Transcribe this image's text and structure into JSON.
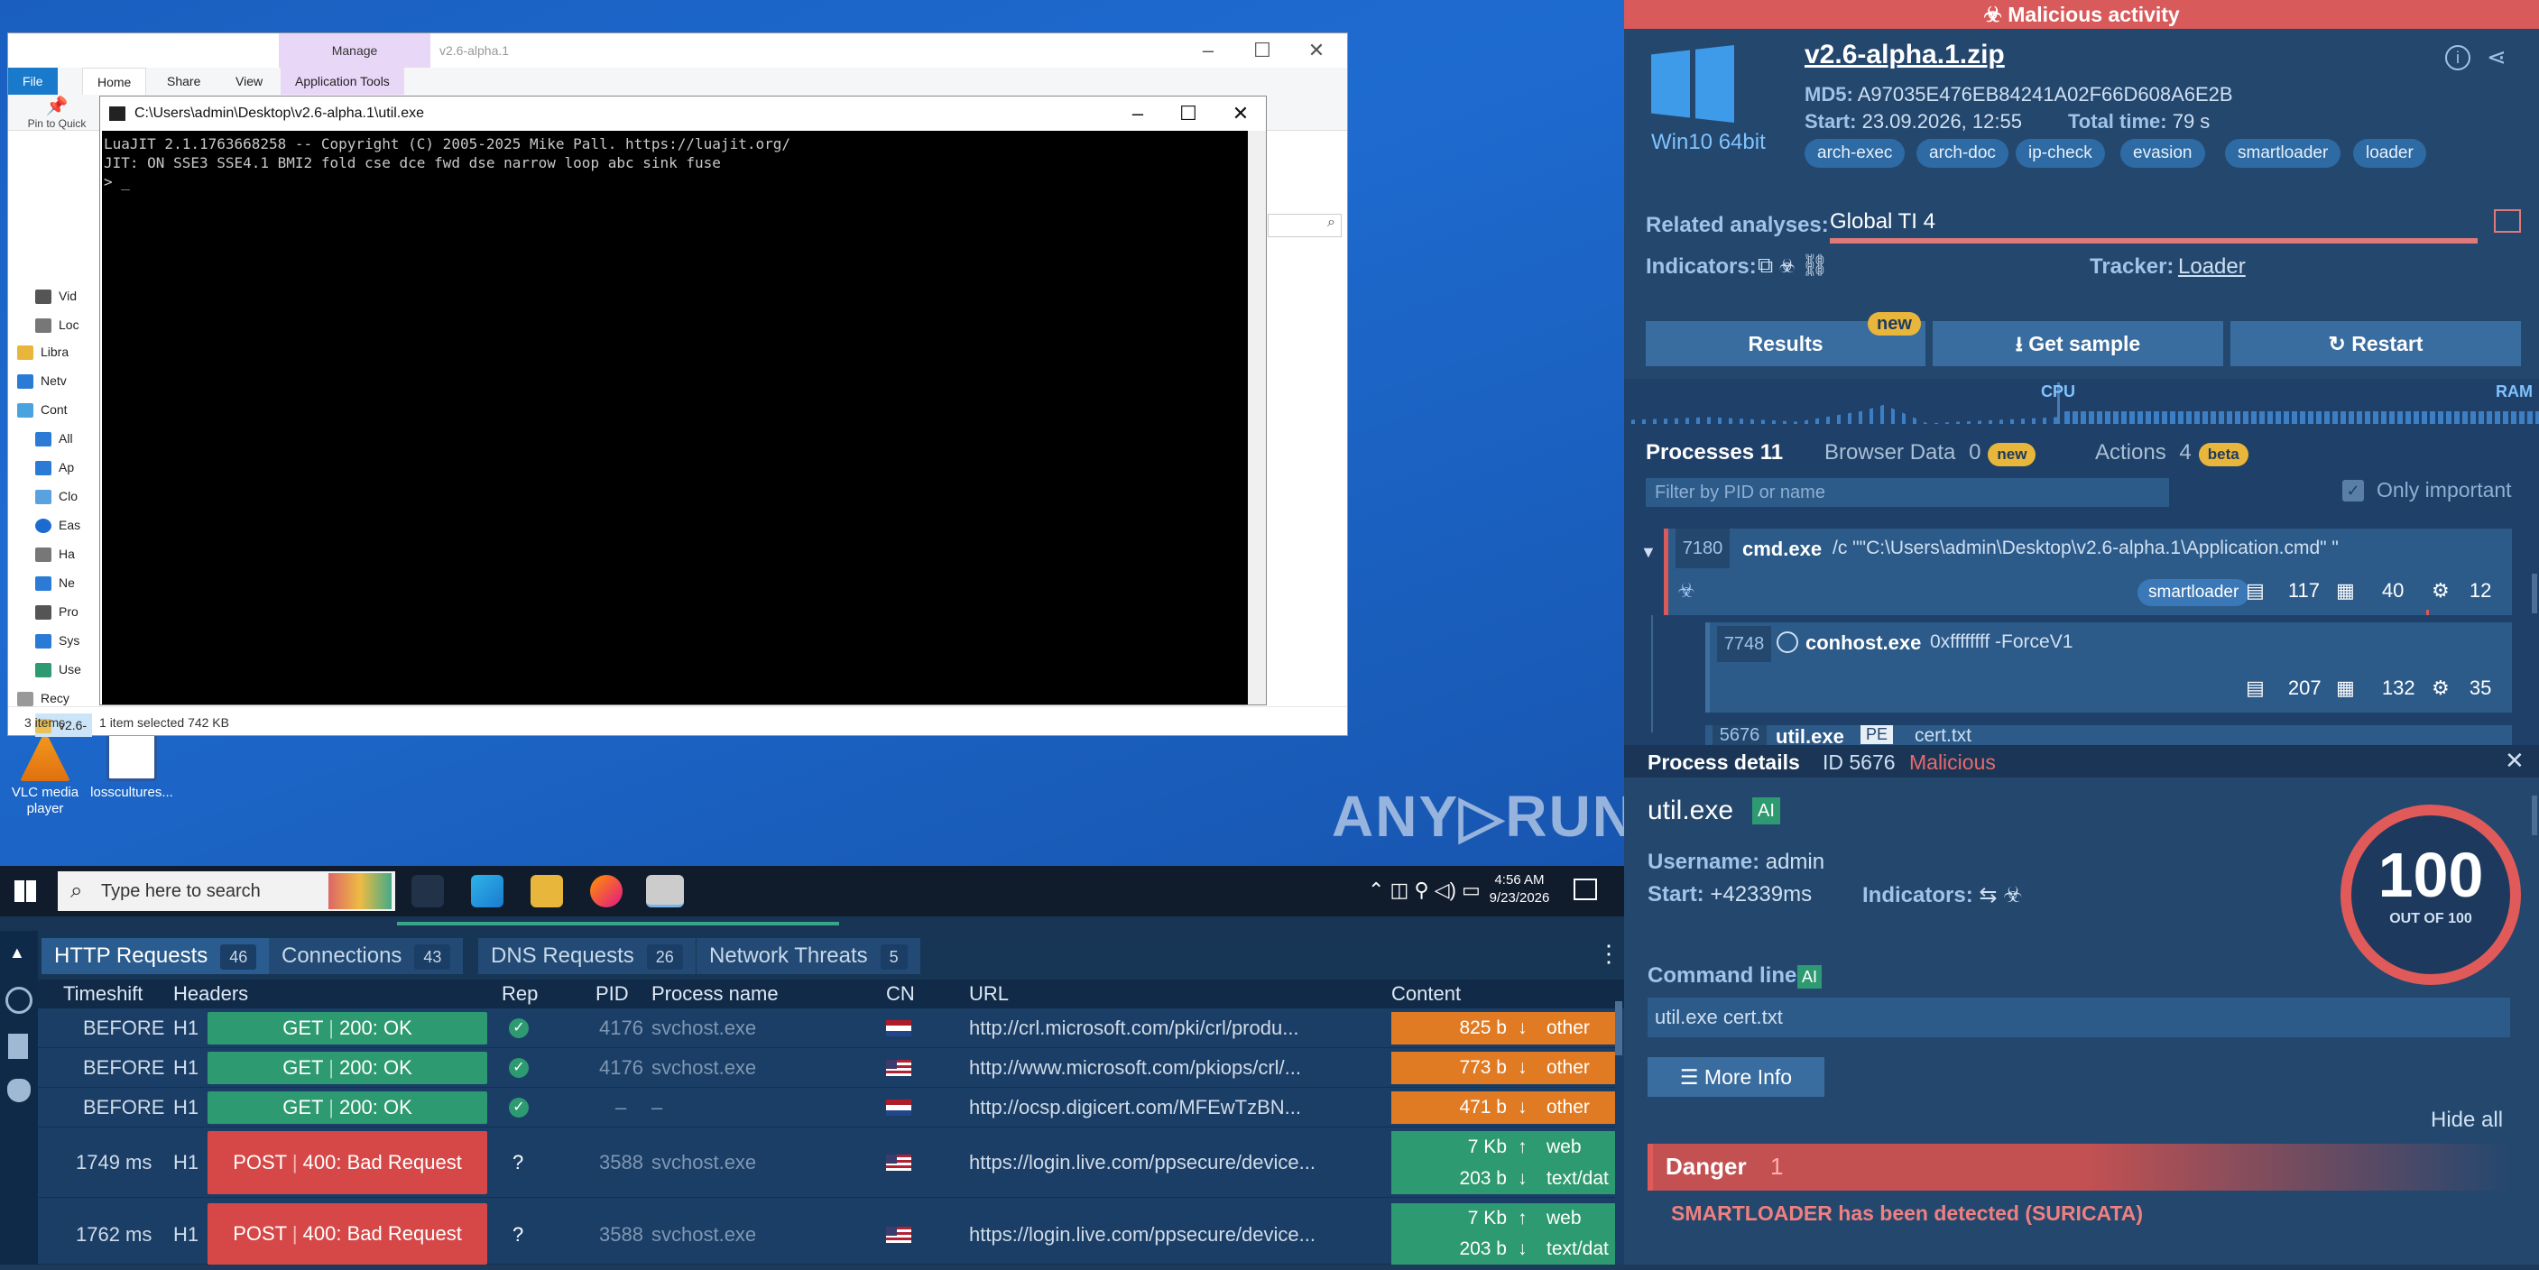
{
  "desktop": {
    "icons": [
      {
        "label": "VLC media player"
      },
      {
        "label": "losscultures..."
      }
    ],
    "watermark": "ANY▷RUN"
  },
  "explorer": {
    "title_path": "v2.6-alpha.1",
    "manage_label": "Manage",
    "tabs": [
      "File",
      "Home",
      "Share",
      "View",
      "Application Tools"
    ],
    "pin_label": "Pin to Quick access",
    "nav_items": [
      "Vid",
      "Loc",
      "Libra",
      "Netv",
      "Cont",
      "All",
      "Ap",
      "Clo",
      "Eas",
      "Ha",
      "Ne",
      "Pro",
      "Sys",
      "Use",
      "Recy",
      "v2.6-"
    ],
    "status_items": "3 items",
    "status_selected": "1 item selected  742 KB"
  },
  "console": {
    "title": "C:\\Users\\admin\\Desktop\\v2.6-alpha.1\\util.exe",
    "lines": [
      "LuaJIT 2.1.1763668258 -- Copyright (C) 2005-2025 Mike Pall. https://luajit.org/",
      "JIT: ON SSE3 SSE4.1 BMI2 fold cse dce fwd dse narrow loop abc sink fuse",
      "> _"
    ]
  },
  "taskbar": {
    "search_placeholder": "Type here to search",
    "time": "4:56 AM",
    "date": "9/23/2026"
  },
  "network": {
    "tabs": [
      {
        "label": "HTTP Requests",
        "count": "46"
      },
      {
        "label": "Connections",
        "count": "43"
      },
      {
        "label": "DNS Requests",
        "count": "26"
      },
      {
        "label": "Network Threats",
        "count": "5"
      }
    ],
    "headers": [
      "Timeshift",
      "Headers",
      "Rep",
      "PID",
      "Process name",
      "CN",
      "URL",
      "Content"
    ],
    "rows": [
      {
        "time": "BEFORE",
        "h": "H1",
        "method": "GET",
        "status": "200: OK",
        "rep": "✓",
        "pid": "4176",
        "proc": "svchost.exe",
        "url": "http://crl.microsoft.com/pki/crl/produ...",
        "size": "825 b",
        "ctype": "other"
      },
      {
        "time": "BEFORE",
        "h": "H1",
        "method": "GET",
        "status": "200: OK",
        "rep": "✓",
        "pid": "4176",
        "proc": "svchost.exe",
        "url": "http://www.microsoft.com/pkiops/crl/...",
        "size": "773 b",
        "ctype": "other"
      },
      {
        "time": "BEFORE",
        "h": "H1",
        "method": "GET",
        "status": "200: OK",
        "rep": "✓",
        "pid": "–",
        "proc": "–",
        "url": "http://ocsp.digicert.com/MFEwTzBN...",
        "size": "471 b",
        "ctype": "other"
      },
      {
        "time": "1749 ms",
        "h": "H1",
        "method": "POST",
        "status": "400: Bad Request",
        "rep": "?",
        "pid": "3588",
        "proc": "svchost.exe",
        "url": "https://login.live.com/ppsecure/device...",
        "size": "7 Kb",
        "ctype": "web",
        "size2": "203 b",
        "ctype2": "text/dat"
      },
      {
        "time": "1762 ms",
        "h": "H1",
        "method": "POST",
        "status": "400: Bad Request",
        "rep": "?",
        "pid": "3588",
        "proc": "svchost.exe",
        "url": "https://login.live.com/ppsecure/device...",
        "size": "7 Kb",
        "ctype": "web",
        "size2": "203 b",
        "ctype2": "text/dat"
      }
    ]
  },
  "analysis": {
    "banner": "Malicious activity",
    "os": "Win10 64bit",
    "file": "v2.6-alpha.1.zip",
    "md5_label": "MD5:",
    "md5": "A97035E476EB84241A02F66D608A6E2B",
    "start_label": "Start:",
    "start": "23.09.2026, 12:55",
    "total_label": "Total time:",
    "total": "79 s",
    "tags": [
      "arch-exec",
      "arch-doc",
      "ip-check",
      "evasion",
      "smartloader",
      "loader"
    ],
    "related_label": "Related analyses:",
    "related": "Global TI 4",
    "indicators_label": "Indicators:",
    "tracker_label": "Tracker:",
    "tracker": "Loader",
    "btn_results": "Results",
    "btn_new": "new",
    "btn_sample": "Get sample",
    "btn_restart": "Restart",
    "cpu": "CPU",
    "ram": "RAM"
  },
  "processes": {
    "tabs": [
      {
        "label": "Processes",
        "count": "11"
      },
      {
        "label": "Browser Data",
        "count": "0",
        "badge": "new"
      },
      {
        "label": "Actions",
        "count": "4",
        "badge": "beta"
      }
    ],
    "filter_placeholder": "Filter by PID or name",
    "only_important": "Only important",
    "list": [
      {
        "pid": "7180",
        "name": "cmd.exe",
        "args": "/c \"\"C:\\Users\\admin\\Desktop\\v2.6-alpha.1\\Application.cmd\" \"",
        "tag": "smartloader",
        "files": "117",
        "reg": "40",
        "mods": "12"
      },
      {
        "pid": "7748",
        "name": "conhost.exe",
        "args": "0xffffffff -ForceV1",
        "files": "207",
        "reg": "132",
        "mods": "35"
      },
      {
        "pid": "5676",
        "name": "util.exe",
        "pe": "PE",
        "args": "cert.txt"
      }
    ]
  },
  "details": {
    "title": "Process details",
    "id_label": "ID 5676",
    "verdict": "Malicious",
    "name": "util.exe",
    "ai": "AI",
    "username_label": "Username:",
    "username": "admin",
    "start_label": "Start:",
    "start": "+42339ms",
    "indicators_label": "Indicators:",
    "score": "100",
    "score_sub": "OUT OF 100",
    "cmdline_label": "Command line",
    "cmdline": "util.exe cert.txt",
    "more_info": "More Info",
    "hide_all": "Hide all",
    "danger_label": "Danger",
    "danger_count": "1",
    "danger_text": "SMARTLOADER has been detected (SURICATA)"
  },
  "colors": {
    "accent": "#2a5c8f",
    "danger": "#d85a5a",
    "ok": "#2e9a72",
    "warn": "#e07b24"
  }
}
